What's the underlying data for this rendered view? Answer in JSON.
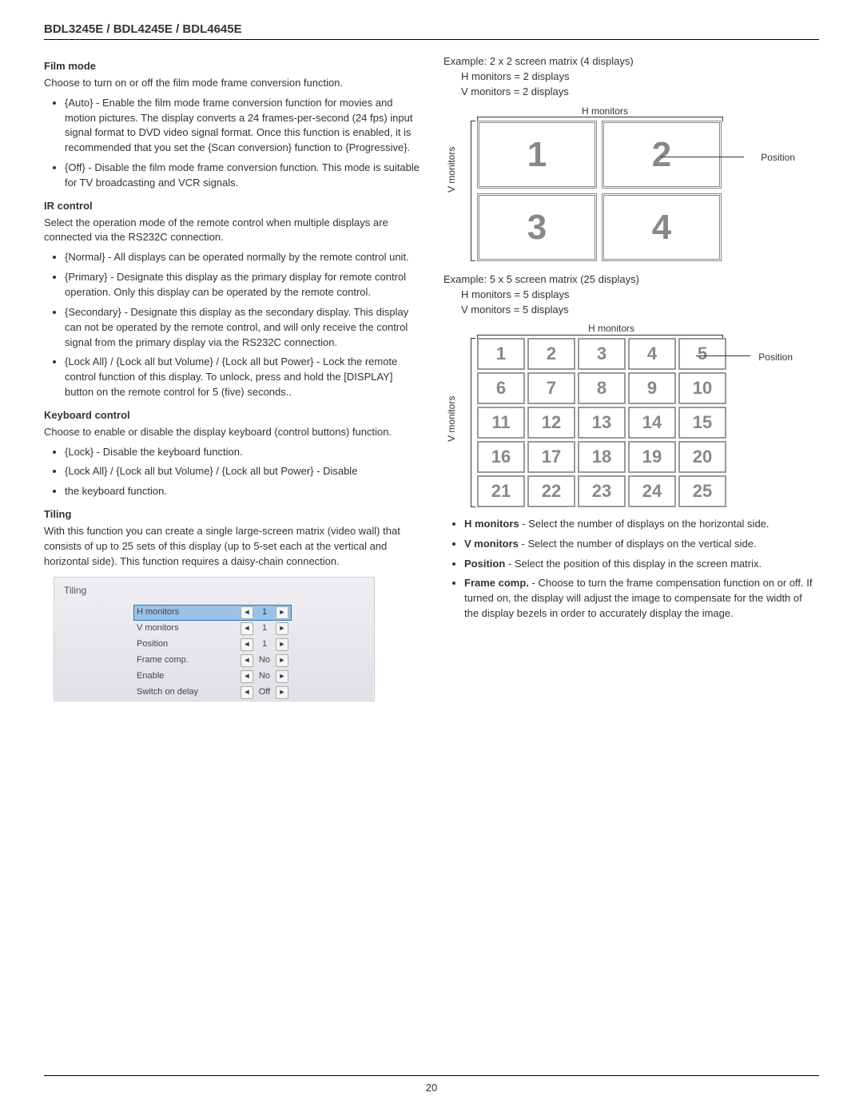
{
  "header": {
    "models": "BDL3245E / BDL4245E / BDL4645E"
  },
  "left": {
    "film": {
      "title": "Film mode",
      "intro": "Choose to turn on or off the film mode frame conversion function.",
      "b1_a": "{Auto}",
      "b1_b": " - Enable the film mode frame conversion function for movies and motion pictures. The display converts a 24 frames-per-second (24 fps) input signal format to DVD video signal format. Once this function is enabled, it is recommended that you set the ",
      "b1_c": "{Scan conversion}",
      "b1_d": " function to ",
      "b1_e": "{Progressive}",
      "b1_f": ".",
      "b2_a": "{Off}",
      "b2_b": " - Disable the film mode frame conversion function. This mode is suitable for TV broadcasting and VCR signals."
    },
    "ir": {
      "title": "IR control",
      "intro": "Select the operation mode of the remote control when multiple displays are connected via the RS232C connection.",
      "b1_a": "{Normal}",
      "b1_b": " - All displays can be operated normally by the remote control unit.",
      "b2_a": "{Primary}",
      "b2_b": " - Designate this display as the primary display for remote control operation. Only this display can be operated by the remote control.",
      "b3_a": "{Secondary}",
      "b3_b": " - Designate this display as the secondary display. This display can not be operated by the remote control, and will only receive the control signal from the primary display via the RS232C connection.",
      "b4_a": "{Lock All}",
      "b4_sep": " / ",
      "b4_b": "{Lock all but Volume}",
      "b4_c": "{Lock all but Power}",
      "b4_d": " - Lock the remote control function of this display. To unlock, press and hold the [",
      "b4_e": "DISPLAY",
      "b4_f": "] button on the remote control for 5 (five) seconds.."
    },
    "kb": {
      "title": "Keyboard control",
      "intro": "Choose to enable or disable the display keyboard (control buttons) function.",
      "b1_a": "{Lock}",
      "b1_b": " - Disable the keyboard function.",
      "b2_a": "{Lock All}",
      "b2_sep": " / ",
      "b2_b": "{Lock all but Volume}",
      "b2_c": "{Lock all but Power}",
      "b2_d": " - Disable",
      "b3": "the keyboard function."
    },
    "tiling": {
      "title": "Tiling",
      "intro1": "With this function you can create a single large-screen matrix (video wall) that consists of up to ",
      "intro_b1": "25",
      "intro2": " sets of this display (",
      "intro_b2": "up to 5-set each at the vertical and horizontal side",
      "intro3": "). This function requires a daisy-chain connection."
    }
  },
  "osd": {
    "title": "Tiling",
    "rows": [
      {
        "label": "H monitors",
        "value": "1",
        "hl": true
      },
      {
        "label": "V monitors",
        "value": "1",
        "hl": false
      },
      {
        "label": "Position",
        "value": "1",
        "hl": false
      },
      {
        "label": "Frame comp.",
        "value": "No",
        "hl": false
      },
      {
        "label": "Enable",
        "value": "No",
        "hl": false
      },
      {
        "label": "Switch on delay",
        "value": "Off",
        "hl": false
      }
    ]
  },
  "right": {
    "ex1_head": "Example: 2 x 2 screen matrix (4 displays)",
    "ex1_h": "H monitors = 2 displays",
    "ex1_v": "V monitors = 2 displays",
    "hlabel": "H monitors",
    "vlabel": "V monitors",
    "position": "Position",
    "grid2": [
      "1",
      "2",
      "3",
      "4"
    ],
    "ex2_head": "Example: 5 x 5 screen matrix (25 displays)",
    "ex2_h": "H monitors = 5 displays",
    "ex2_v": "V monitors = 5 displays",
    "grid5": [
      "1",
      "2",
      "3",
      "4",
      "5",
      "6",
      "7",
      "8",
      "9",
      "10",
      "11",
      "12",
      "13",
      "14",
      "15",
      "16",
      "17",
      "18",
      "19",
      "20",
      "21",
      "22",
      "23",
      "24",
      "25"
    ],
    "defs": {
      "h_a": "H monitors",
      "h_b": " - Select the number of displays on the horizontal side.",
      "v_a": "V monitors",
      "v_b": " - Select the number of displays on the vertical side.",
      "p_a": "Position",
      "p_b": " - Select the position of this display in the screen matrix.",
      "f_a": "Frame comp.",
      "f_b": " - Choose to turn the frame compensation function on or off. If turned on, the display will adjust the image to compensate for the width of the display bezels in order to accurately display the image."
    }
  },
  "footer": {
    "page": "20"
  }
}
